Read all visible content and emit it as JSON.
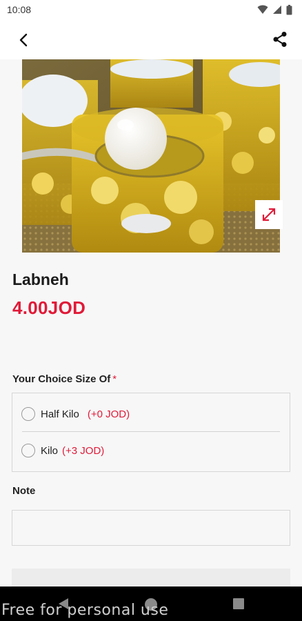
{
  "status_bar": {
    "time": "10:08"
  },
  "product": {
    "name": "Labneh",
    "price": "4.00JOD",
    "image_alt": "Labneh balls in olive oil jars"
  },
  "options": {
    "label": "Your Choice Size Of",
    "required_mark": "*",
    "items": [
      {
        "name": "Half Kilo",
        "extra": "(+0 JOD)"
      },
      {
        "name": "Kilo",
        "extra": "(+3 JOD)"
      }
    ]
  },
  "note": {
    "label": "Note",
    "placeholder": "",
    "value": ""
  },
  "watermark": "Free for personal use",
  "colors": {
    "accent": "#e01a38",
    "border": "#d6d6d6",
    "background": "#f7f7f7"
  },
  "icons": {
    "back": "chevron-left-icon",
    "share": "share-icon",
    "expand": "expand-icon"
  }
}
